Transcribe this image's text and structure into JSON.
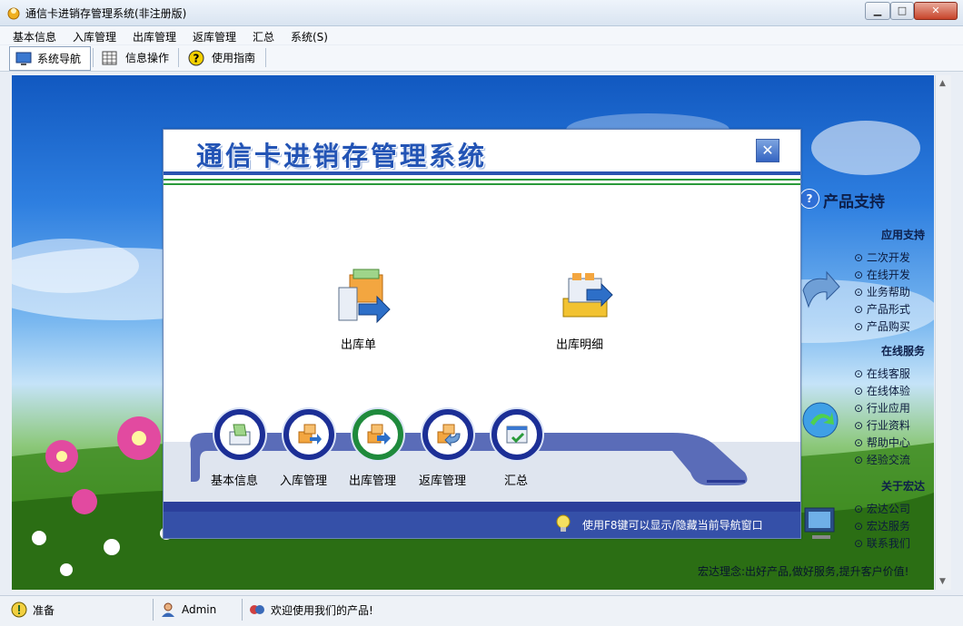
{
  "window": {
    "title": "通信卡进销存管理系统(非注册版)"
  },
  "menu": [
    "基本信息",
    "入库管理",
    "出库管理",
    "返库管理",
    "汇总",
    "系统(S)"
  ],
  "toolbar": {
    "items": [
      "系统导航",
      "信息操作",
      "使用指南"
    ]
  },
  "right_panel": {
    "heading": "产品支持",
    "sections": [
      {
        "title": "应用支持",
        "links": [
          "二次开发",
          "在线开发",
          "业务帮助",
          "产品形式",
          "产品购买"
        ]
      },
      {
        "title": "在线服务",
        "links": [
          "在线客服",
          "在线体验",
          "行业应用",
          "行业资料",
          "帮助中心",
          "经验交流"
        ]
      },
      {
        "title": "关于宏达",
        "links": [
          "宏达公司",
          "宏达服务",
          "联系我们"
        ]
      }
    ],
    "slogan": "宏达理念:出好产品,做好服务,提升客户价值!"
  },
  "nav_dialog": {
    "title": "通信卡进销存管理系统",
    "close_glyph": "✕",
    "main_items": [
      "出库单",
      "出库明细"
    ],
    "bottom_items": [
      "基本信息",
      "入库管理",
      "出库管理",
      "返库管理",
      "汇总"
    ],
    "hint": "使用F8键可以显示/隐藏当前导航窗口"
  },
  "status": {
    "state": "准备",
    "user": "Admin",
    "welcome": "欢迎使用我们的产品!"
  },
  "colors": {
    "accent": "#2354b5",
    "ring": "#1c2f96",
    "ring_active": "#1f8a3c"
  }
}
